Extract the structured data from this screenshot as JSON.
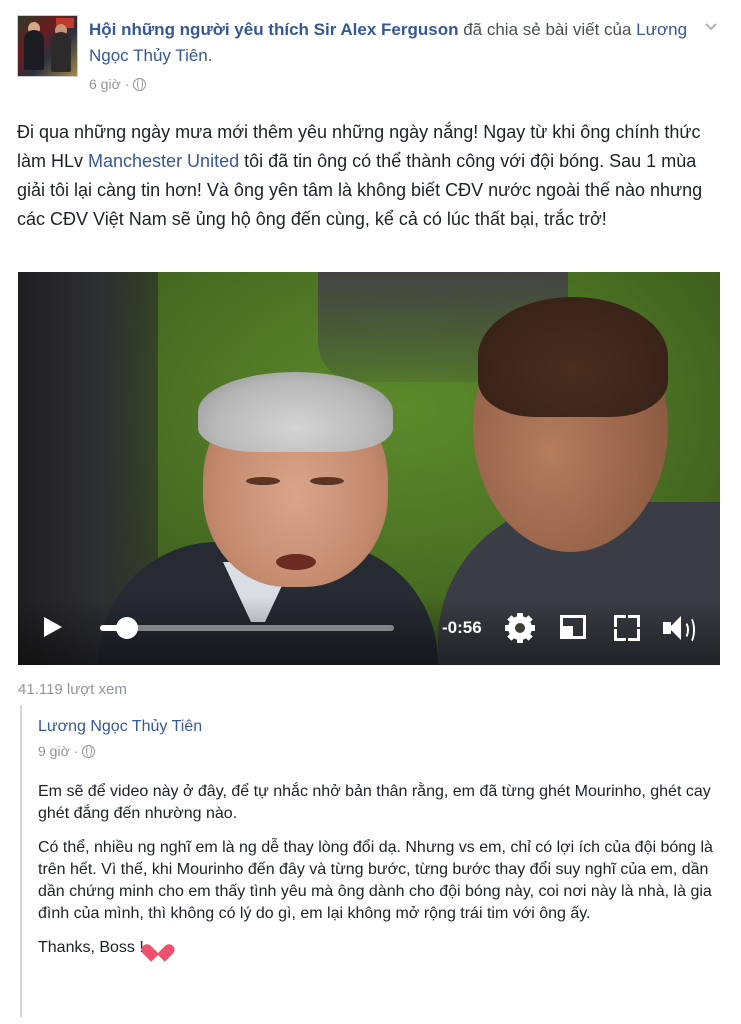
{
  "post": {
    "page_name": "Hội những người yêu thích Sir Alex Ferguson",
    "shared_text": "đã chia sẻ bài viết của",
    "shared_author": "Lương Ngọc Thủy Tiên",
    "time": "6 giờ ·",
    "body_before_link": "Đi qua những ngày mưa mới thêm yêu những ngày nắng! Ngay từ khi ông chính thức làm HLv ",
    "body_link": "Manchester United",
    "body_after_link": " tôi đã tin ông có thể thành công với đội bóng. Sau 1 mùa giải tôi lại càng tin hơn! Và ông yên tâm là không biết CĐV nước ngoài thế nào nhưng các CĐV Việt Nam sẽ ủng hộ ông đến cùng, kể cả có lúc thất bại, trắc trở!"
  },
  "video": {
    "time_remaining": "-0:56",
    "progress": 0.09,
    "views": "41.119 lượt xem"
  },
  "shared": {
    "author": "Lương Ngọc Thủy Tiên",
    "time": "9 giờ ·",
    "para1": "Em sẽ để video này ở đây, để tự nhắc nhở bản thân rằng, em đã từng ghét Mourinho, ghét cay ghét đắng đến nhường nào.",
    "para2": "Có thể, nhiều ng nghĩ em là ng dễ thay lòng đổi dạ. Nhưng vs em, chỉ có lợi ích của đội bóng là trên hết. Vì thế, khi Mourinho đến đây và từng bước, từng bước thay đổi suy nghĩ của em, dần dần chứng minh cho em thấy tình yêu mà ông dành cho đội bóng này, coi nơi này là nhà, là gia đình của mình, thì không có lý do gì, em lại không mở rộng trái tim với ông ấy.",
    "para3": "Thanks, Boss !"
  },
  "colors": {
    "link": "#365899",
    "meta": "#90949c",
    "heart": "#f0506e"
  }
}
